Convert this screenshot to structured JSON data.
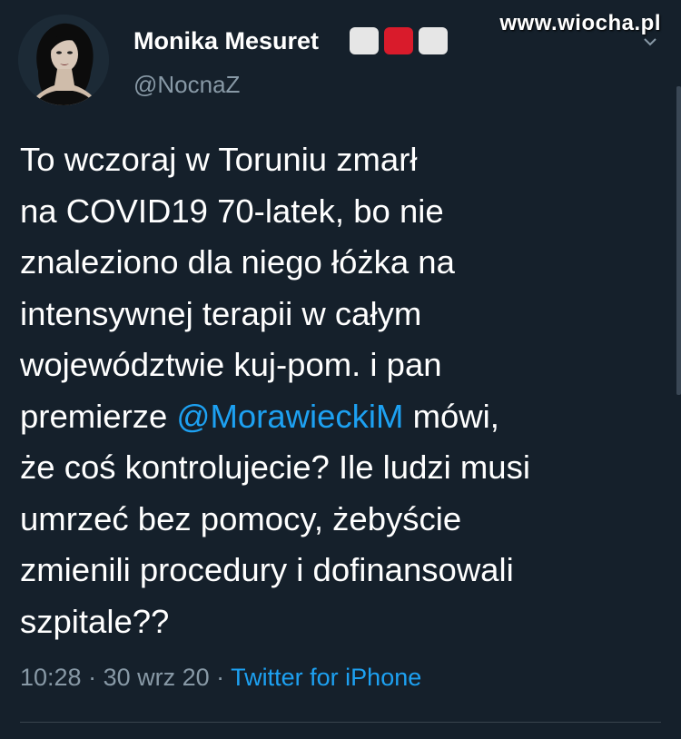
{
  "watermark": "www.wiocha.pl",
  "author": {
    "name": "Monika Mesuret",
    "handle": "@NocnaZ",
    "flag_colors": [
      "#e6e6e6",
      "#d91b2b",
      "#e6e6e6"
    ]
  },
  "tweet": {
    "lines": [
      "To wczoraj w Toruniu zmarł",
      "na COVID19 70-latek, bo nie",
      "znaleziono dla niego łóżka na",
      "intensywnej terapii w całym",
      "województwie kuj-pom. i pan",
      {
        "before": "premierze ",
        "mention": "@MorawieckiM",
        "after": " mówi,"
      },
      "że coś kontrolujecie? Ile ludzi musi",
      "umrzeć bez pomocy, żebyście",
      "zmienili procedury i dofinansowali",
      "szpitale??"
    ]
  },
  "meta": {
    "time": "10:28",
    "separator": " · ",
    "date": "30 wrz 20",
    "source": "Twitter for iPhone"
  },
  "colors": {
    "background": "#15202b",
    "text": "#ffffff",
    "secondary": "#8899a6",
    "link": "#1da1f2"
  },
  "icons": {
    "menu": "chevron-down-icon"
  }
}
